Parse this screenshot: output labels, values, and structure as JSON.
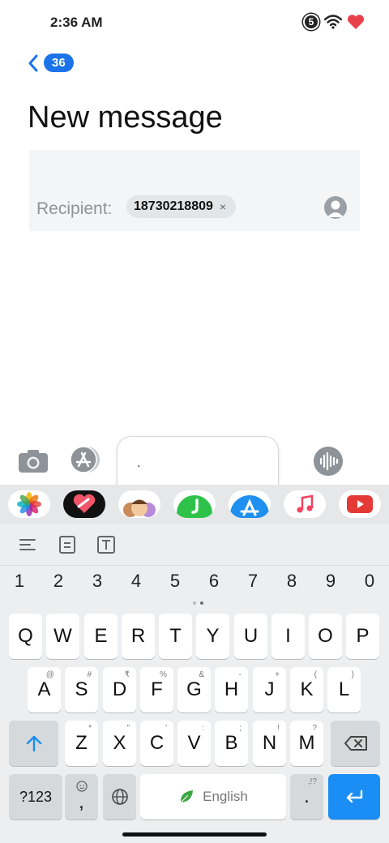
{
  "status_bar": {
    "time": "2:36 AM",
    "badge_number": "5",
    "icons": [
      "circle-5-icon",
      "wifi-icon",
      "heart-battery-icon"
    ]
  },
  "header": {
    "back_count": "36",
    "title": "New message"
  },
  "recipient": {
    "label": "Recipient:",
    "number": "18730218809",
    "remove_glyph": "×"
  },
  "compose": {
    "input_text": "."
  },
  "app_strip": {
    "apps": [
      "photos-app-icon",
      "digital-touch-app-icon",
      "memoji-app-icon",
      "green-app-icon",
      "app-store-icon",
      "music-app-icon",
      "youtube-app-icon"
    ]
  },
  "keyboard": {
    "toolbar": [
      "text-align-icon",
      "document-icon",
      "text-format-icon"
    ],
    "numbers": [
      "1",
      "2",
      "3",
      "4",
      "5",
      "6",
      "7",
      "8",
      "9",
      "0"
    ],
    "row1": [
      "Q",
      "W",
      "E",
      "R",
      "T",
      "Y",
      "U",
      "I",
      "O",
      "P"
    ],
    "row2": [
      "A",
      "S",
      "D",
      "F",
      "G",
      "H",
      "J",
      "K",
      "L"
    ],
    "row2_hints": [
      "@",
      "#",
      "₹",
      "%",
      "&",
      "-",
      "+",
      "(",
      ")"
    ],
    "row3": [
      "Z",
      "X",
      "C",
      "V",
      "B",
      "N",
      "M"
    ],
    "row3_hints": [
      "*",
      "\"",
      "'",
      ":",
      ";",
      "!",
      "?"
    ],
    "symbols_label": "?123",
    "comma": ",",
    "space_label": "English",
    "period": ".",
    "period_hint": ",!?"
  },
  "colors": {
    "accent": "#1a73e8",
    "enter_key": "#1a8ef5",
    "keyboard_bg": "#eceef0"
  }
}
